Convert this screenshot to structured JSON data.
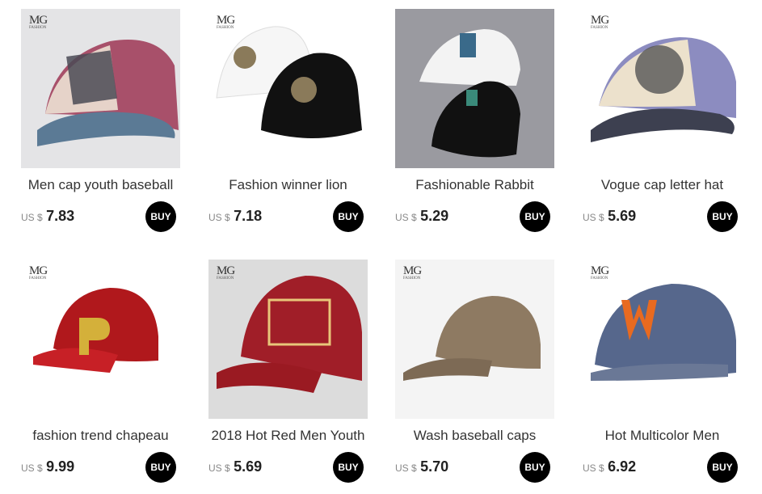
{
  "products": [
    {
      "title": "Men cap youth baseball",
      "currency": "US $",
      "price": "7.83",
      "buy": "BUY",
      "brand": "MG"
    },
    {
      "title": "Fashion winner lion",
      "currency": "US $",
      "price": "7.18",
      "buy": "BUY",
      "brand": "MG"
    },
    {
      "title": "Fashionable Rabbit",
      "currency": "US $",
      "price": "5.29",
      "buy": "BUY",
      "brand": ""
    },
    {
      "title": "Vogue cap letter hat",
      "currency": "US $",
      "price": "5.69",
      "buy": "BUY",
      "brand": "MG"
    },
    {
      "title": "fashion trend chapeau",
      "currency": "US $",
      "price": "9.99",
      "buy": "BUY",
      "brand": "MG"
    },
    {
      "title": "2018 Hot Red Men Youth",
      "currency": "US $",
      "price": "5.69",
      "buy": "BUY",
      "brand": "MG"
    },
    {
      "title": "Wash baseball caps",
      "currency": "US $",
      "price": "5.70",
      "buy": "BUY",
      "brand": "MG"
    },
    {
      "title": "Hot Multicolor Men",
      "currency": "US $",
      "price": "6.92",
      "buy": "BUY",
      "brand": "MG"
    }
  ],
  "colors": {
    "buy_bg": "#000000",
    "price": "#222222",
    "title": "#333333"
  }
}
